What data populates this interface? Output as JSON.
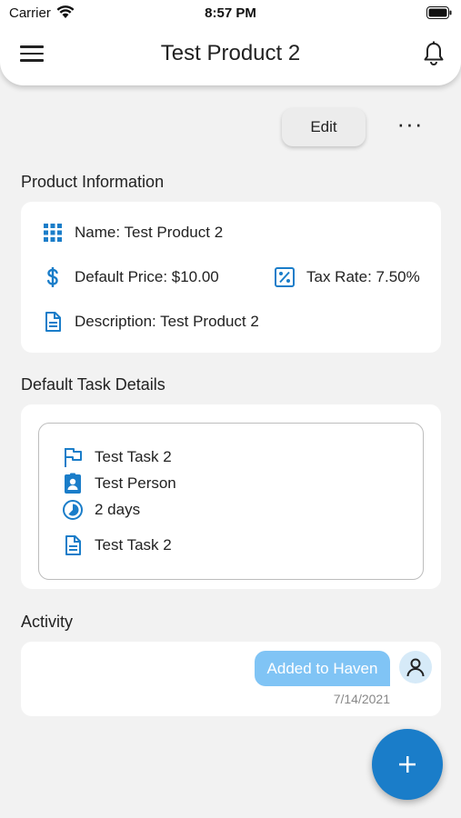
{
  "status_bar": {
    "carrier": "Carrier",
    "time": "8:57 PM"
  },
  "header": {
    "title": "Test Product 2"
  },
  "actions": {
    "edit_label": "Edit",
    "more_label": "···"
  },
  "product_info": {
    "section_title": "Product Information",
    "name": "Name: Test Product 2",
    "default_price": "Default Price: $10.00",
    "tax_rate": "Tax Rate: 7.50%",
    "description": "Description: Test Product 2"
  },
  "task_details": {
    "section_title": "Default Task Details",
    "task_name": "Test Task 2",
    "assignee": "Test Person",
    "duration": "2 days",
    "description": "Test Task 2"
  },
  "activity": {
    "section_title": "Activity",
    "message": "Added to Haven",
    "date": "7/14/2021"
  },
  "colors": {
    "accent": "#1a7dc9",
    "bubble": "#80c4f5",
    "background": "#f2f2f2"
  }
}
